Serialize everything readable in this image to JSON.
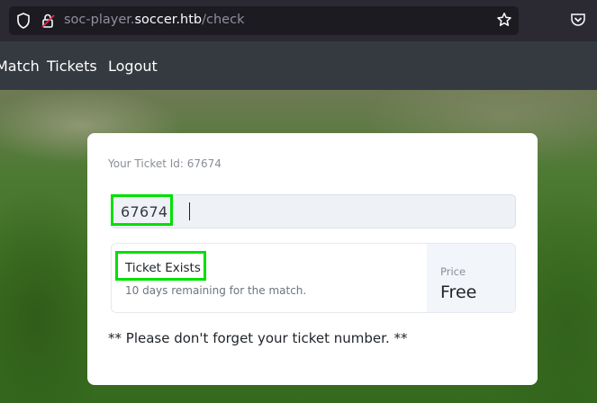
{
  "browser": {
    "url_prefix": "soc-player.",
    "url_host": "soccer.htb",
    "url_path": "/check",
    "icons": [
      "shield-icon",
      "lock-icon",
      "star-icon",
      "pocket-icon"
    ]
  },
  "nav": {
    "match_label": "Match",
    "tickets_label": "Tickets",
    "logout_label": "Logout"
  },
  "card": {
    "ticket_id_label": "Your Ticket Id: 67674",
    "input_value": "67674",
    "status_title": "Ticket Exists",
    "status_subtitle": "10 days remaining for the match.",
    "price_label": "Price",
    "price_value": "Free",
    "reminder": "** Please don't forget your ticket number. **"
  },
  "colors": {
    "highlight": "#00e000",
    "nav_bg": "#343a40"
  }
}
